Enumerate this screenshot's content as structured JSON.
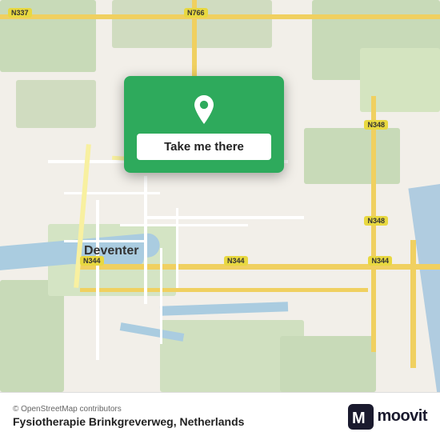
{
  "map": {
    "city": "Deventer",
    "country": "Netherlands"
  },
  "road_labels": {
    "n337": "N337",
    "n766": "N766",
    "n344_left": "N344",
    "n344_mid": "N344",
    "n344_right": "N344",
    "n348_top": "N348",
    "n348_bot": "N348"
  },
  "popup": {
    "button_label": "Take me there"
  },
  "bottom_bar": {
    "osm_credit": "© OpenStreetMap contributors",
    "location_name": "Fysiotherapie Brinkgreverweg, Netherlands",
    "moovit_label": "moovit"
  }
}
